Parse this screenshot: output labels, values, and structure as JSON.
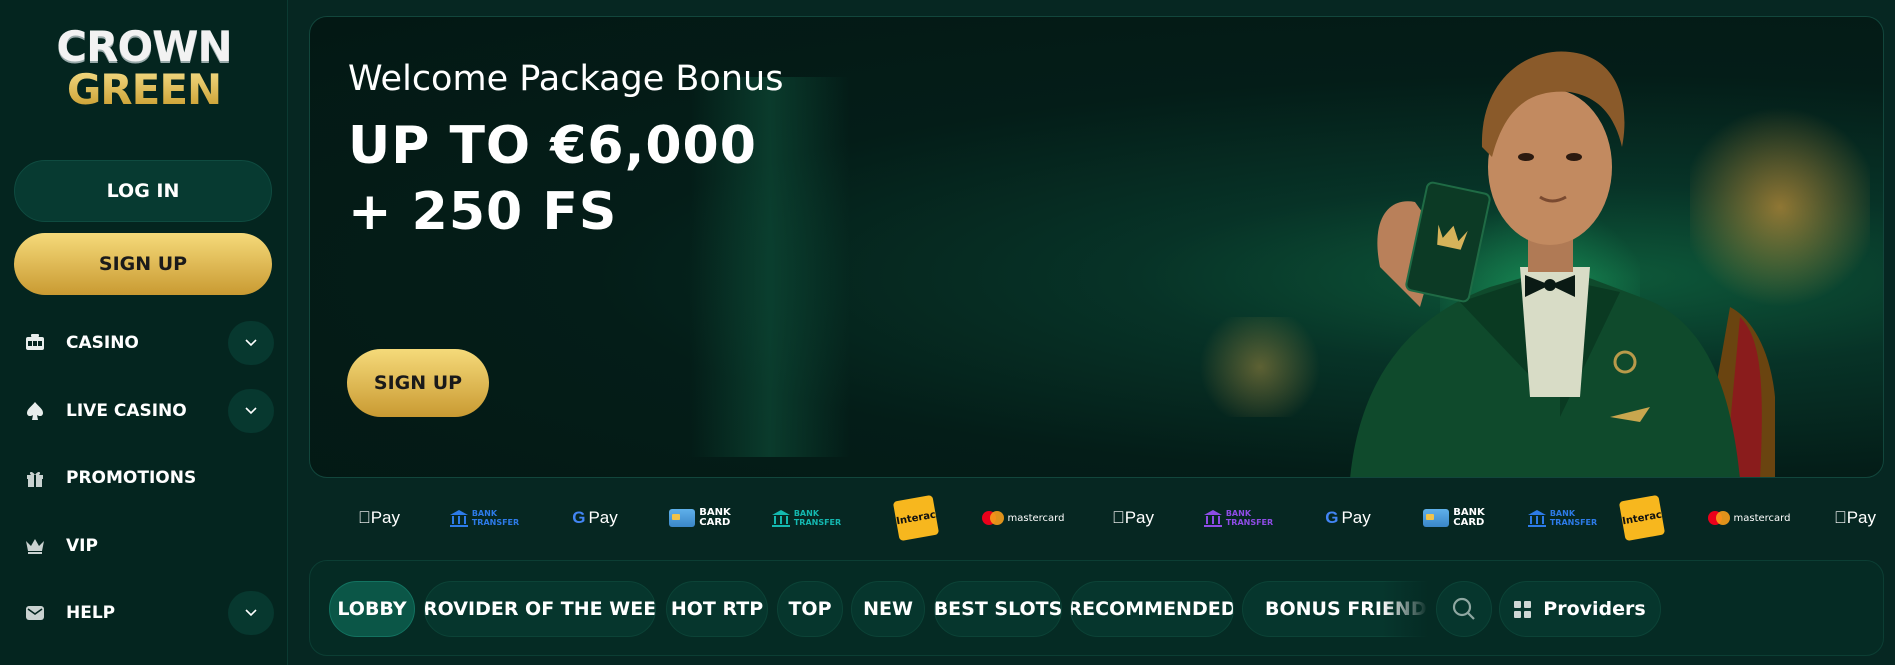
{
  "logo": {
    "line1": "CROWN",
    "line2": "GREEN"
  },
  "auth": {
    "login_label": "LOG IN",
    "signup_label": "SIGN UP"
  },
  "sidebar": {
    "items": [
      {
        "label": "CASINO",
        "icon": "slot-machine-icon",
        "expandable": true
      },
      {
        "label": "LIVE CASINO",
        "icon": "spade-icon",
        "expandable": true
      },
      {
        "label": "PROMOTIONS",
        "icon": "gift-icon",
        "expandable": false
      },
      {
        "label": "VIP",
        "icon": "crown-icon",
        "expandable": false
      },
      {
        "label": "HELP",
        "icon": "message-icon",
        "expandable": true
      }
    ]
  },
  "hero": {
    "subtitle": "Welcome Package Bonus",
    "title_line1": "UP TO €6,000",
    "title_line2": "+ 250 FS",
    "cta_label": "SIGN UP"
  },
  "payments": {
    "apple_pay": "Pay",
    "google_pay": "Pay",
    "bank_transfer_1": "BANK",
    "bank_transfer_2": "TRANSFER",
    "bank_card_1": "BANK",
    "bank_card_2": "CARD",
    "interac": "Interac",
    "mastercard": "mastercard"
  },
  "categories": {
    "tabs": [
      "LOBBY",
      "PROVIDER OF THE WEEK",
      "HOT RTP",
      "TOP",
      "NEW",
      "BEST SLOTS",
      "RECOMMENDED",
      "BONUS FRIENDLY"
    ],
    "active_tab": "LOBBY",
    "providers_label": "Providers"
  },
  "colors": {
    "gold": "#e6c25a",
    "background": "#062722",
    "accent_green": "#0b5647"
  }
}
